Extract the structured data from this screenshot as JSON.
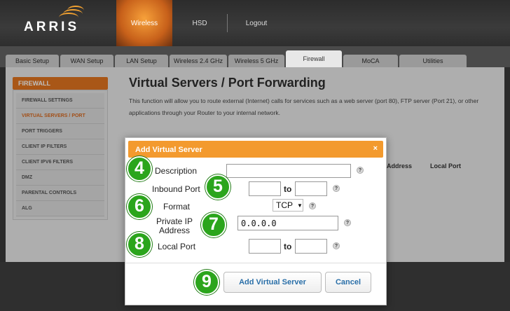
{
  "header": {
    "brand": "ARRIS",
    "nav": [
      {
        "label": "Wireless",
        "active": true
      },
      {
        "label": "HSD",
        "active": false
      },
      {
        "label": "Logout",
        "active": false
      }
    ]
  },
  "tabs": [
    {
      "label": "Basic Setup",
      "w": 76
    },
    {
      "label": "WAN Setup",
      "w": 76
    },
    {
      "label": "LAN Setup",
      "w": 76
    },
    {
      "label": "Wireless 2.4 GHz",
      "w": 82
    },
    {
      "label": "Wireless 5 GHz",
      "w": 80
    },
    {
      "label": "Firewall",
      "w": 80,
      "active": true
    },
    {
      "label": "MoCA",
      "w": 78
    },
    {
      "label": "Utilities",
      "w": 96
    }
  ],
  "sidebar": {
    "heading": "FIREWALL",
    "items": [
      {
        "label": "FIREWALL SETTINGS"
      },
      {
        "label": "VIRTUAL SERVERS / PORT",
        "active": true
      },
      {
        "label": "PORT TRIGGERS"
      },
      {
        "label": "CLIENT IP FILTERS"
      },
      {
        "label": "CLIENT IPV6 FILTERS"
      },
      {
        "label": "DMZ"
      },
      {
        "label": "PARENTAL CONTROLS"
      },
      {
        "label": "ALG"
      }
    ]
  },
  "page": {
    "title": "Virtual Servers / Port Forwarding",
    "description": "This function will allow you to route external (Internet) calls for services such as a web server (port 80), FTP server (Port 21), or other applications through your Router to your internal network.",
    "column_address": "Address",
    "column_local_port": "Local Port"
  },
  "dialog": {
    "title": "Add Virtual Server",
    "close_label": "×",
    "description_label": "Description",
    "description_value": "",
    "inbound_port_label": "Inbound Port",
    "inbound_from": "",
    "inbound_to": "",
    "to_label": "to",
    "format_label": "Format",
    "format_value": "TCP",
    "private_ip_label_line1": "Private IP",
    "private_ip_label_line2": "Address",
    "private_ip_value": "0.0.0.0",
    "local_port_label": "Local Port",
    "local_from": "",
    "local_to": "",
    "help_label": "?",
    "add_button": "Add Virtual Server",
    "cancel_button": "Cancel"
  },
  "badges": {
    "description": "4",
    "inbound": "5",
    "format": "6",
    "private_ip": "7",
    "local_port": "8",
    "add": "9"
  },
  "colors": {
    "accent_orange": "#f39a2e",
    "badge_green": "#2ba51c",
    "button_text_blue": "#2a6fa8"
  }
}
